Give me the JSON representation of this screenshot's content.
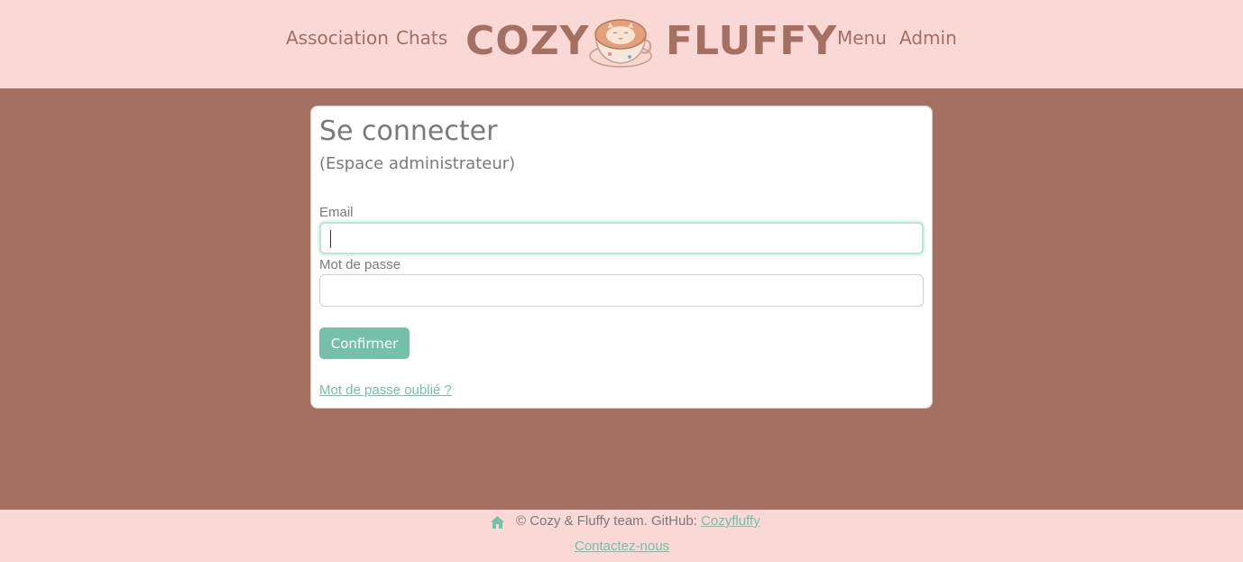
{
  "header": {
    "nav_left": [
      "Association",
      "Chats"
    ],
    "brand_left": "COZY",
    "brand_right": "FLUFFY",
    "nav_right": [
      "Menu",
      "Admin"
    ],
    "logo_icon": "latte-cup-icon"
  },
  "login": {
    "title": "Se connecter",
    "subtitle": "(Espace administrateur)",
    "email_label": "Email",
    "email_value": "",
    "password_label": "Mot de passe",
    "password_value": "",
    "submit_label": "Confirmer",
    "forgot_link": "Mot de passe oublié ?"
  },
  "footer": {
    "home_icon": "home-icon",
    "copyright": "© Cozy & Fluffy team. GitHub: ",
    "github_link": "Cozyfluffy",
    "contact_link": "Contactez-nous"
  },
  "colors": {
    "header_bg": "#fad8d6",
    "page_bg": "#a37062",
    "brand": "#a37062",
    "accent": "#74c0a9",
    "text_muted": "#7a7a7a"
  }
}
